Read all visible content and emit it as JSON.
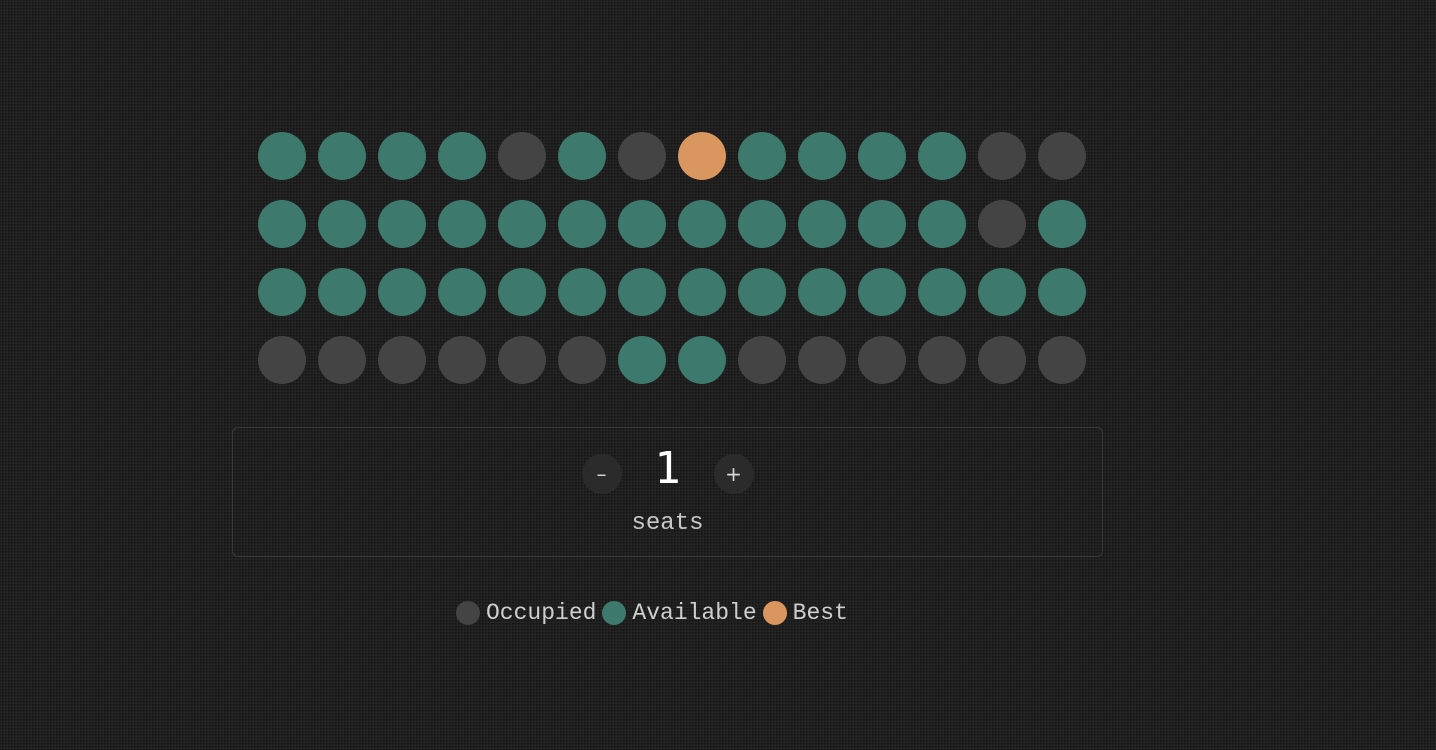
{
  "colors": {
    "occupied": "#444444",
    "available": "#3d7a6d",
    "best": "#d9975f"
  },
  "seat_map": {
    "rows": [
      [
        "available",
        "available",
        "available",
        "available",
        "occupied",
        "available",
        "occupied",
        "best",
        "available",
        "available",
        "available",
        "available",
        "occupied",
        "occupied"
      ],
      [
        "available",
        "available",
        "available",
        "available",
        "available",
        "available",
        "available",
        "available",
        "available",
        "available",
        "available",
        "available",
        "occupied",
        "available"
      ],
      [
        "available",
        "available",
        "available",
        "available",
        "available",
        "available",
        "available",
        "available",
        "available",
        "available",
        "available",
        "available",
        "available",
        "available"
      ],
      [
        "occupied",
        "occupied",
        "occupied",
        "occupied",
        "occupied",
        "occupied",
        "available",
        "available",
        "occupied",
        "occupied",
        "occupied",
        "occupied",
        "occupied",
        "occupied"
      ]
    ]
  },
  "stepper": {
    "decrement_label": "–",
    "increment_label": "+",
    "count": "1",
    "unit_label": "seats"
  },
  "legend": [
    {
      "status": "occupied",
      "label": "Occupied"
    },
    {
      "status": "available",
      "label": "Available"
    },
    {
      "status": "best",
      "label": "Best"
    }
  ]
}
